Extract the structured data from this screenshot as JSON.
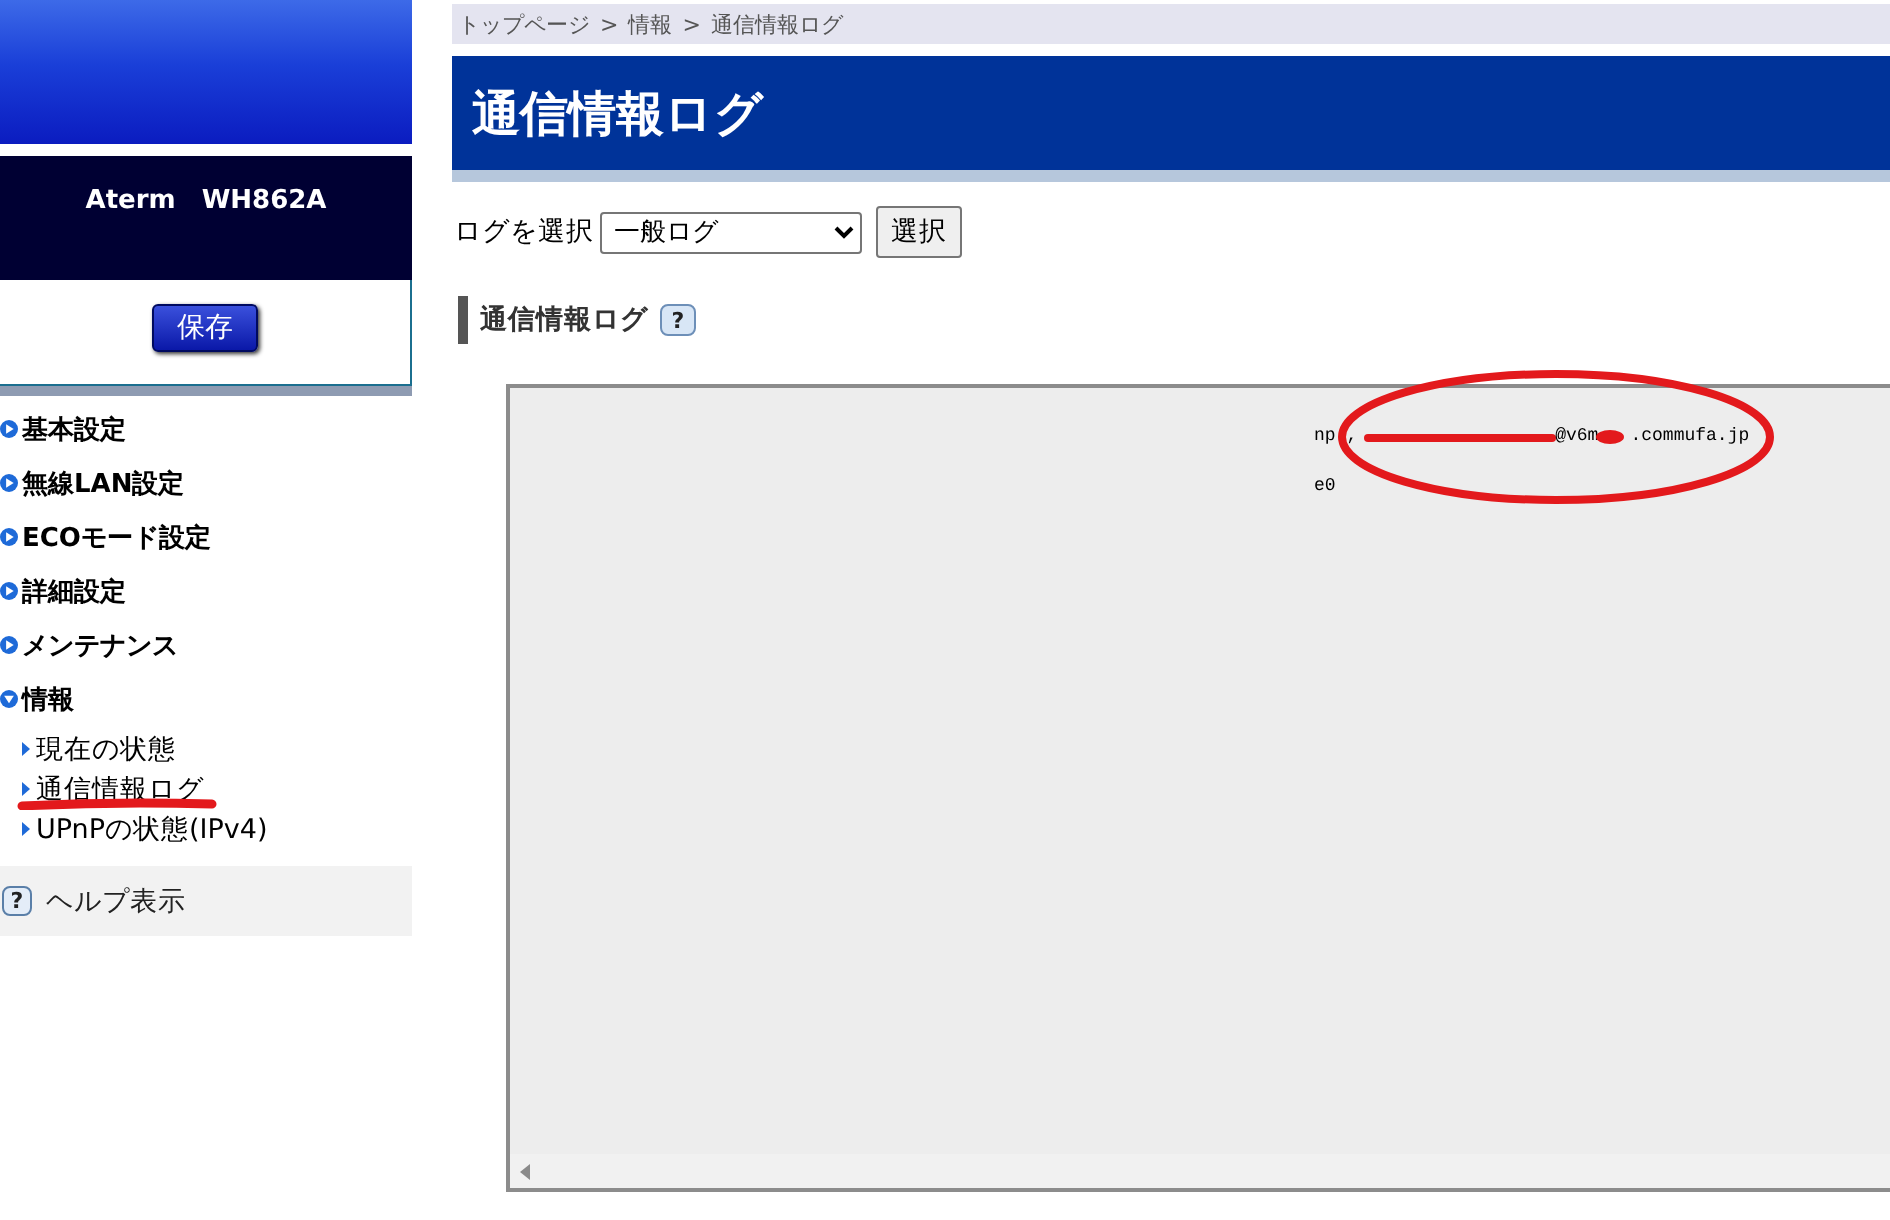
{
  "sidebar": {
    "product_name": "Aterm　WH862A",
    "save_button": "保存",
    "menu": [
      {
        "label": "基本設定",
        "expanded": false
      },
      {
        "label": "無線LAN設定",
        "expanded": false
      },
      {
        "label": "ECOモード設定",
        "expanded": false
      },
      {
        "label": "詳細設定",
        "expanded": false
      },
      {
        "label": "メンテナンス",
        "expanded": false
      },
      {
        "label": "情報",
        "expanded": true,
        "children": [
          {
            "label": "現在の状態",
            "marked": false
          },
          {
            "label": "通信情報ログ",
            "marked": true
          },
          {
            "label": "UPnPの状態(IPv4)",
            "marked": false
          }
        ]
      }
    ],
    "help": {
      "icon": "?",
      "label": "ヘルプ表示"
    }
  },
  "breadcrumb": [
    {
      "label": "トップページ",
      "separator": ">"
    },
    {
      "label": "情報",
      "separator": ">"
    },
    {
      "label": "通信情報ログ"
    }
  ],
  "page_title": "通信情報ログ",
  "log_select": {
    "label": "ログを選択",
    "value": "一般ログ",
    "button": "選択"
  },
  "section": {
    "title": "通信情報ログ",
    "help_icon": "?"
  },
  "log": {
    "circled": true,
    "lines": [
      {
        "segments": [
          {
            "kind": "text",
            "text": "np ,"
          },
          {
            "kind": "scribble"
          },
          {
            "kind": "text",
            "text": "@v6m"
          },
          {
            "kind": "blot"
          },
          {
            "kind": "text",
            "text": ".commufa.jp"
          }
        ]
      },
      {
        "segments": [
          {
            "kind": "text",
            "text": "e0"
          }
        ]
      }
    ]
  }
}
